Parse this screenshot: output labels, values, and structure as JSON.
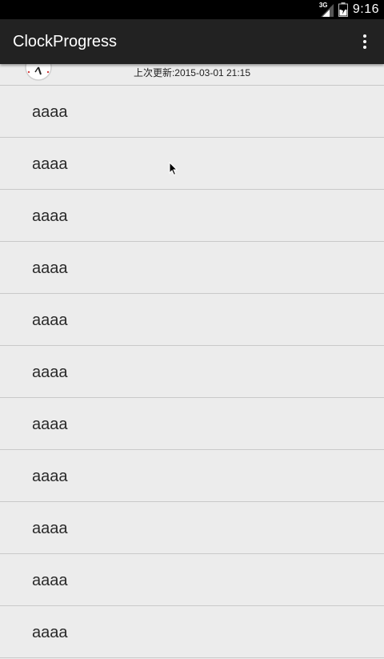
{
  "status_bar": {
    "network": "3G",
    "time": "9:16"
  },
  "action_bar": {
    "title": "ClockProgress",
    "overflow_icon": "more-vert-icon"
  },
  "refresh_header": {
    "icon": "clock-icon",
    "last_update": "上次更新:2015-03-01 21:15"
  },
  "list": {
    "items": [
      {
        "label": "aaaa"
      },
      {
        "label": "aaaa"
      },
      {
        "label": "aaaa"
      },
      {
        "label": "aaaa"
      },
      {
        "label": "aaaa"
      },
      {
        "label": "aaaa"
      },
      {
        "label": "aaaa"
      },
      {
        "label": "aaaa"
      },
      {
        "label": "aaaa"
      },
      {
        "label": "aaaa"
      },
      {
        "label": "aaaa"
      }
    ]
  },
  "colors": {
    "status_bar": "#000000",
    "action_bar": "#222222",
    "background": "#ececec",
    "divider": "#c9c9c9",
    "text": "#2a2a2a"
  }
}
